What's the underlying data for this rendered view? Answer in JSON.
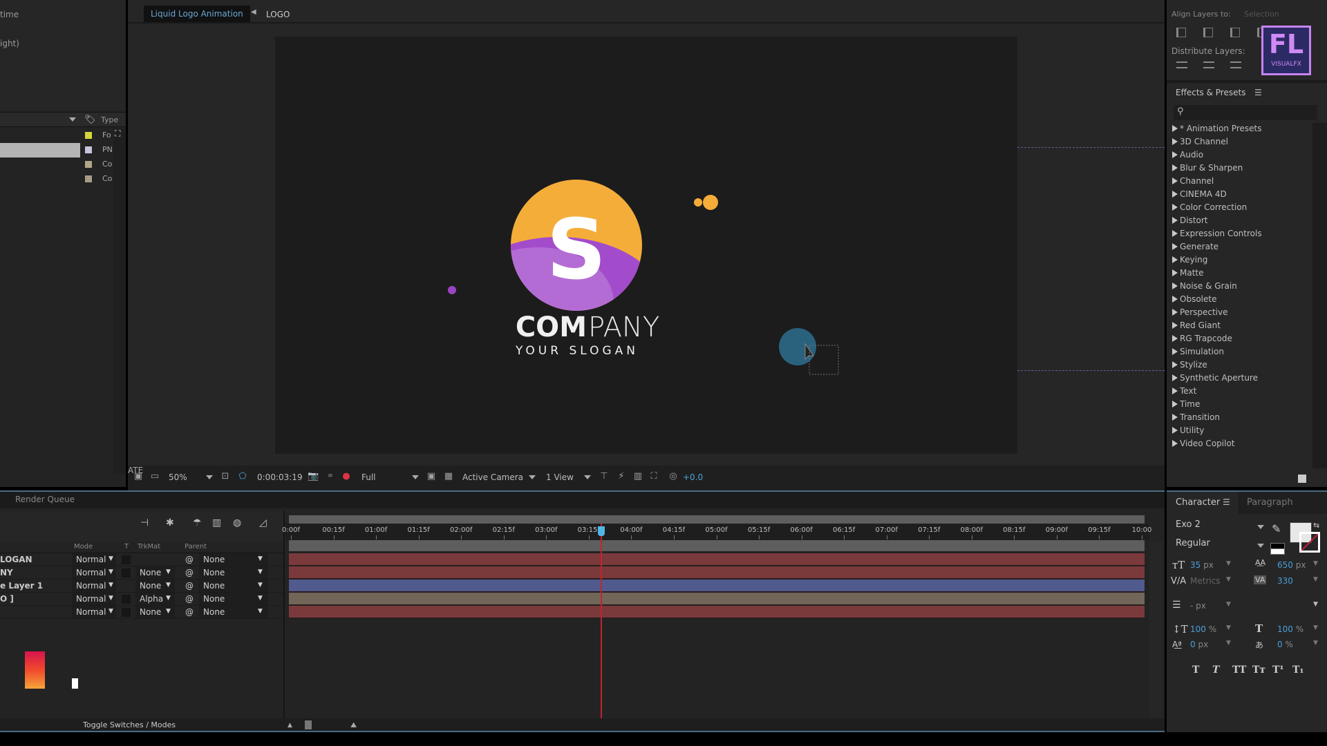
{
  "project": {
    "info_line1": "time",
    "info_line2": "ight)",
    "header_type": "Type",
    "items": [
      {
        "type": "Fo",
        "color": "#d6d63a",
        "selected": false
      },
      {
        "type": "PN",
        "color": "#c9c3dc",
        "selected": true
      },
      {
        "type": "Co",
        "color": "#b4a586",
        "selected": false
      },
      {
        "type": "Co",
        "color": "#a89c86",
        "selected": false
      }
    ]
  },
  "viewer": {
    "tabs": [
      {
        "label": "Liquid Logo Animation",
        "active": true
      },
      {
        "label": "LOGO",
        "active": false
      }
    ],
    "composition": {
      "logo_letter": "S",
      "company_bold": "COM",
      "company_light": "PANY",
      "slogan": "YOUR SLOGAN"
    },
    "toolbar": {
      "zoom": "50%",
      "timecode": "0:00:03:19",
      "resolution": "Full",
      "camera": "Active Camera",
      "views": "1 View",
      "exposure": "+0.0"
    }
  },
  "align": {
    "align_label": "Align Layers to:",
    "align_target": "Selection",
    "distribute_label": "Distribute Layers:",
    "watermark_main": "FL",
    "watermark_sub": "VISUALFX"
  },
  "effects": {
    "title": "Effects & Presets",
    "search_placeholder": "",
    "items": [
      "* Animation Presets",
      "3D Channel",
      "Audio",
      "Blur & Sharpen",
      "Channel",
      "CINEMA 4D",
      "Color Correction",
      "Distort",
      "Expression Controls",
      "Generate",
      "Keying",
      "Matte",
      "Noise & Grain",
      "Obsolete",
      "Perspective",
      "Red Giant",
      "RG Trapcode",
      "Simulation",
      "Stylize",
      "Synthetic Aperture",
      "Text",
      "Time",
      "Transition",
      "Utility",
      "Video Copilot"
    ]
  },
  "timeline": {
    "render_queue_tab": "Render Queue",
    "columns": {
      "mode": "Mode",
      "t": "T",
      "trkmat": "TrkMat",
      "parent": "Parent"
    },
    "layers": [
      {
        "name": "LOGAN",
        "mode": "Normal",
        "trkmat": "",
        "parent": "None",
        "bar_color": "#7a3a3c"
      },
      {
        "name": "NY",
        "mode": "Normal",
        "trkmat": "None",
        "parent": "None",
        "bar_color": "#7a3a3c"
      },
      {
        "name": "e Layer 1",
        "mode": "Normal",
        "trkmat": "None",
        "parent": "None",
        "bar_color": "#515a8c"
      },
      {
        "name": "O ]",
        "mode": "Normal",
        "trkmat": "Alpha",
        "parent": "None",
        "bar_color": "#726658"
      },
      {
        "name": "",
        "mode": "Normal",
        "trkmat": "None",
        "parent": "None",
        "bar_color": "#7a3a3c"
      }
    ],
    "ruler": [
      "0:00f",
      "00:15f",
      "01:00f",
      "01:15f",
      "02:00f",
      "02:15f",
      "03:00f",
      "03:15f",
      "04:00f",
      "04:15f",
      "05:00f",
      "05:15f",
      "06:00f",
      "06:15f",
      "07:00f",
      "07:15f",
      "08:00f",
      "08:15f",
      "09:00f",
      "09:15f",
      "10:00"
    ],
    "playhead_fraction": 0.364,
    "toggle_label": "Toggle Switches / Modes"
  },
  "character": {
    "tab_character": "Character",
    "tab_paragraph": "Paragraph",
    "font": "Exo 2",
    "style": "Regular",
    "size": "35",
    "size_unit": "px",
    "leading": "650",
    "leading_unit": "px",
    "kerning": "Metrics",
    "tracking": "330",
    "stroke": "- px",
    "vscale": "100",
    "hscale": "100",
    "baseline": "0",
    "baseline_unit": "px",
    "tsume": "0",
    "pct": "%",
    "styles": [
      "T",
      "T",
      "TT",
      "Tт",
      "T¹",
      "T₁"
    ]
  }
}
